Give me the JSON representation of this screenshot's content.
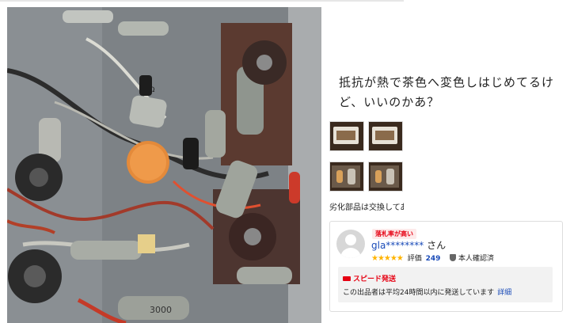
{
  "caption": "抵抗が熱で茶色へ変色しはじめてるけど、いいのかあ？",
  "degraded_text": "劣化部品は交換してあ",
  "thumbnails": [
    "radio-front-1",
    "radio-front-2",
    "chassis-top-1",
    "chassis-top-2"
  ],
  "seller": {
    "badge": "落札率が高い",
    "name": "gla********",
    "suffix": "さん",
    "stars": "★★★★★",
    "rating_label": "評価",
    "rating_count": "249",
    "verified_label": "本人確認済",
    "shipping_title": "スピード発送",
    "shipping_desc": "この出品者は平均24時間以内に発送しています",
    "detail_link": "詳細"
  },
  "photo_text": {
    "label1": "4KΩ",
    "label2": "3000"
  },
  "colors": {
    "link": "#1a4bb8",
    "accent_red": "#e60012",
    "star": "#ffb400"
  }
}
